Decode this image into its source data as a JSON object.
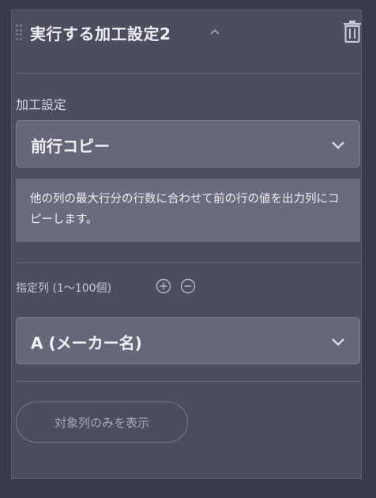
{
  "card": {
    "title": "実行する加工設定2",
    "icons": {
      "drag": "drag-handle-icon",
      "collapse": "chevron-up-icon",
      "delete": "trash-icon"
    }
  },
  "processing": {
    "label": "加工設定",
    "selected": "前行コピー",
    "description": "他の列の最大行分の行数に合わせて前の行の値を出力列にコピーします。"
  },
  "columns": {
    "label": "指定列 (1〜100個)",
    "selected": "A (メーカー名)"
  },
  "actions": {
    "show_target_only": "対象列のみを表示"
  }
}
